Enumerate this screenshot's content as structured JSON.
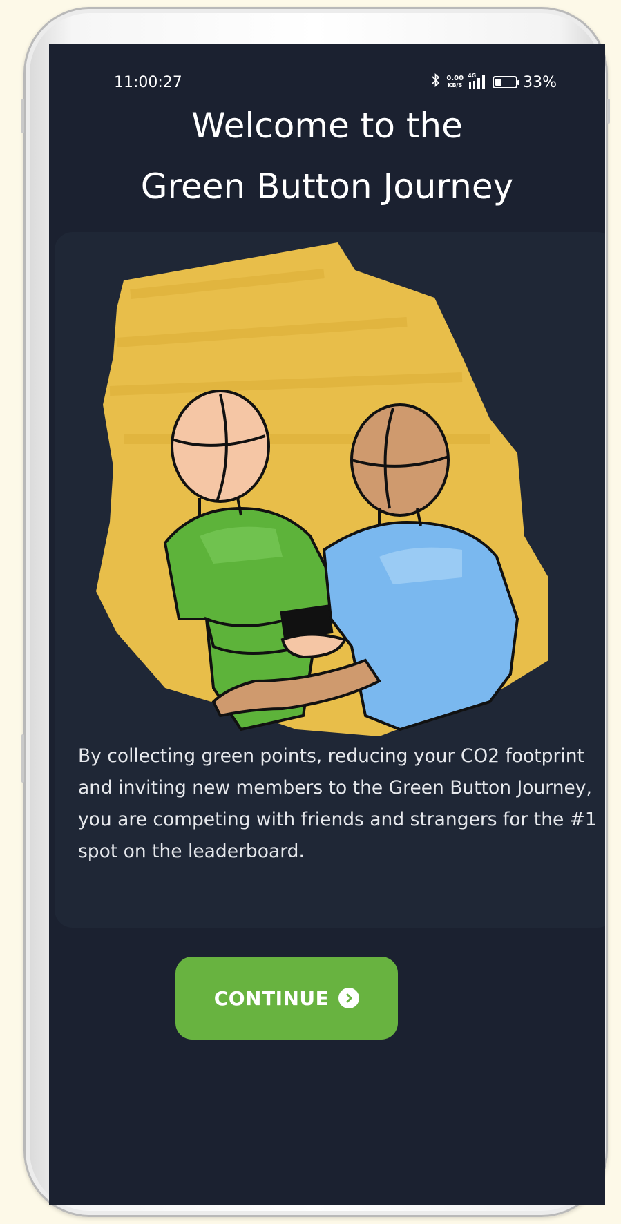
{
  "status_bar": {
    "time": "11:00:27",
    "net_speed_value": "0.00",
    "net_speed_unit": "KB/S",
    "network": "4G",
    "battery_percent": "33%",
    "battery_level": 0.33
  },
  "title": {
    "line1": "Welcome to the",
    "line2": "Green Button Journey"
  },
  "card": {
    "illustration": "two-people-handshake-illustration",
    "description": "By collecting green points, reducing your CO2 footprint and inviting new members to the Green Button Journey, you are competing with friends and strangers for the #1 spot on the leaderboard."
  },
  "continue_button": {
    "label": "CONTINUE",
    "icon": "chevron-right-circle-icon"
  },
  "colors": {
    "screen_bg": "#1b2130",
    "card_bg": "#1f2736",
    "button_green": "#68b340",
    "splash_yellow": "#e8be4a",
    "shirt_green": "#5db33a",
    "shirt_blue": "#7ab8ef"
  }
}
